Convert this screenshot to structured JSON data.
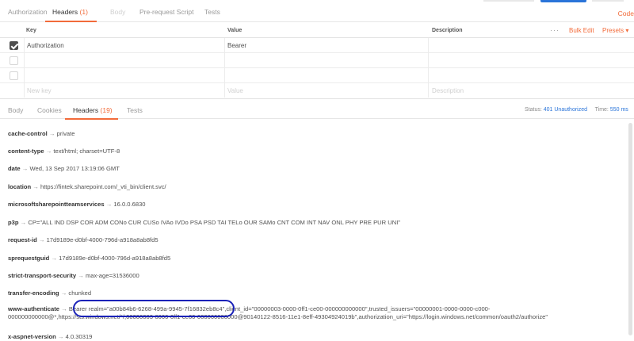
{
  "request_tabs": [
    {
      "label": "Authorization",
      "count": "",
      "state": "normal"
    },
    {
      "label": "Headers",
      "count": "(1)",
      "state": "active"
    },
    {
      "label": "Body",
      "count": "",
      "state": "disabled"
    },
    {
      "label": "Pre-request Script",
      "count": "",
      "state": "normal"
    },
    {
      "label": "Tests",
      "count": "",
      "state": "normal"
    }
  ],
  "code_link": "Code",
  "table": {
    "col_key": "Key",
    "col_value": "Value",
    "col_description": "Description",
    "more": "···",
    "bulk_edit": "Bulk Edit",
    "presets": "Presets ▾",
    "rows": [
      {
        "checked": true,
        "key": "Authorization",
        "value": "Bearer",
        "description": ""
      },
      {
        "checked": false,
        "key": "",
        "value": "",
        "description": ""
      },
      {
        "checked": false,
        "key": "",
        "value": "",
        "description": ""
      }
    ],
    "placeholder_key": "New key",
    "placeholder_value": "Value",
    "placeholder_description": "Description"
  },
  "response_tabs": [
    {
      "label": "Body",
      "count": "",
      "state": "normal"
    },
    {
      "label": "Cookies",
      "count": "",
      "state": "normal"
    },
    {
      "label": "Headers",
      "count": "(19)",
      "state": "active"
    },
    {
      "label": "Tests",
      "count": "",
      "state": "normal"
    }
  ],
  "status": {
    "status_label": "Status:",
    "status_value": "401 Unauthorized",
    "time_label": "Time:",
    "time_value": "550 ms"
  },
  "arrow": "→",
  "response_headers": [
    {
      "key": "cache-control",
      "value": "private"
    },
    {
      "key": "content-type",
      "value": "text/html; charset=UTF-8"
    },
    {
      "key": "date",
      "value": "Wed, 13 Sep 2017 13:19:06 GMT"
    },
    {
      "key": "location",
      "value": "https://fintek.sharepoint.com/_vti_bin/client.svc/"
    },
    {
      "key": "microsoftsharepointteamservices",
      "value": "16.0.0.6830"
    },
    {
      "key": "p3p",
      "value": "CP=\"ALL IND DSP COR ADM CONo CUR CUSo IVAo IVDo PSA PSD TAI TELo OUR SAMo CNT COM INT NAV ONL PHY PRE PUR UNI\""
    },
    {
      "key": "request-id",
      "value": "17d9189e-d0bf-4000-796d-a918a8ab8fd5"
    },
    {
      "key": "sprequestguid",
      "value": "17d9189e-d0bf-4000-796d-a918a8ab8fd5"
    },
    {
      "key": "strict-transport-security",
      "value": "max-age=31536000"
    },
    {
      "key": "transfer-encoding",
      "value": "chunked"
    }
  ],
  "www_authenticate": {
    "key": "www-authenticate",
    "line1": "Bearer realm=\"a00b84b6-6268-499a-9945-7f16832eb8c4\",client_id=\"00000003-0000-0ff1-ce00-000000000000\",trusted_issuers=\"00000001-0000-0000-c000-",
    "line2": "000000000000@*,https://sts.windows.net/*/,00000003-0000-0ff1-ce00-000000000000@90140122-8516-11e1-8eff-49304924019b\",authorization_uri=\"https://login.windows.net/common/oauth2/authorize\""
  },
  "last_header": {
    "key": "x-aspnet-version",
    "value": "4.0.30319"
  }
}
